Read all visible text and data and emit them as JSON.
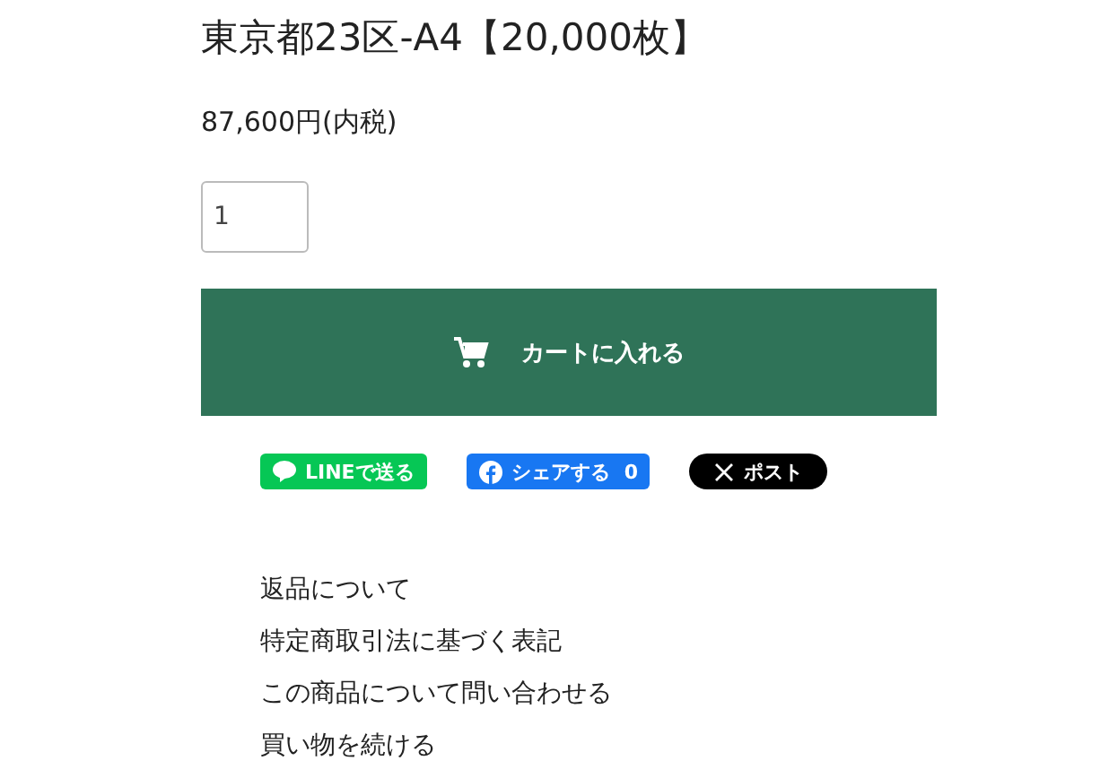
{
  "product": {
    "title": "東京都23区-A4【20,000枚】",
    "price": "87,600円(内税)",
    "quantity": "1"
  },
  "cart_button": {
    "label": "カートに入れる"
  },
  "share_buttons": [
    {
      "kind": "line",
      "label": "LINEで送る"
    },
    {
      "kind": "facebook",
      "label": "シェアする",
      "count": "0"
    },
    {
      "kind": "x",
      "label": "ポスト"
    }
  ],
  "links": [
    "返品について",
    "特定商取引法に基づく表記",
    "この商品について問い合わせる",
    "買い物を続ける"
  ]
}
